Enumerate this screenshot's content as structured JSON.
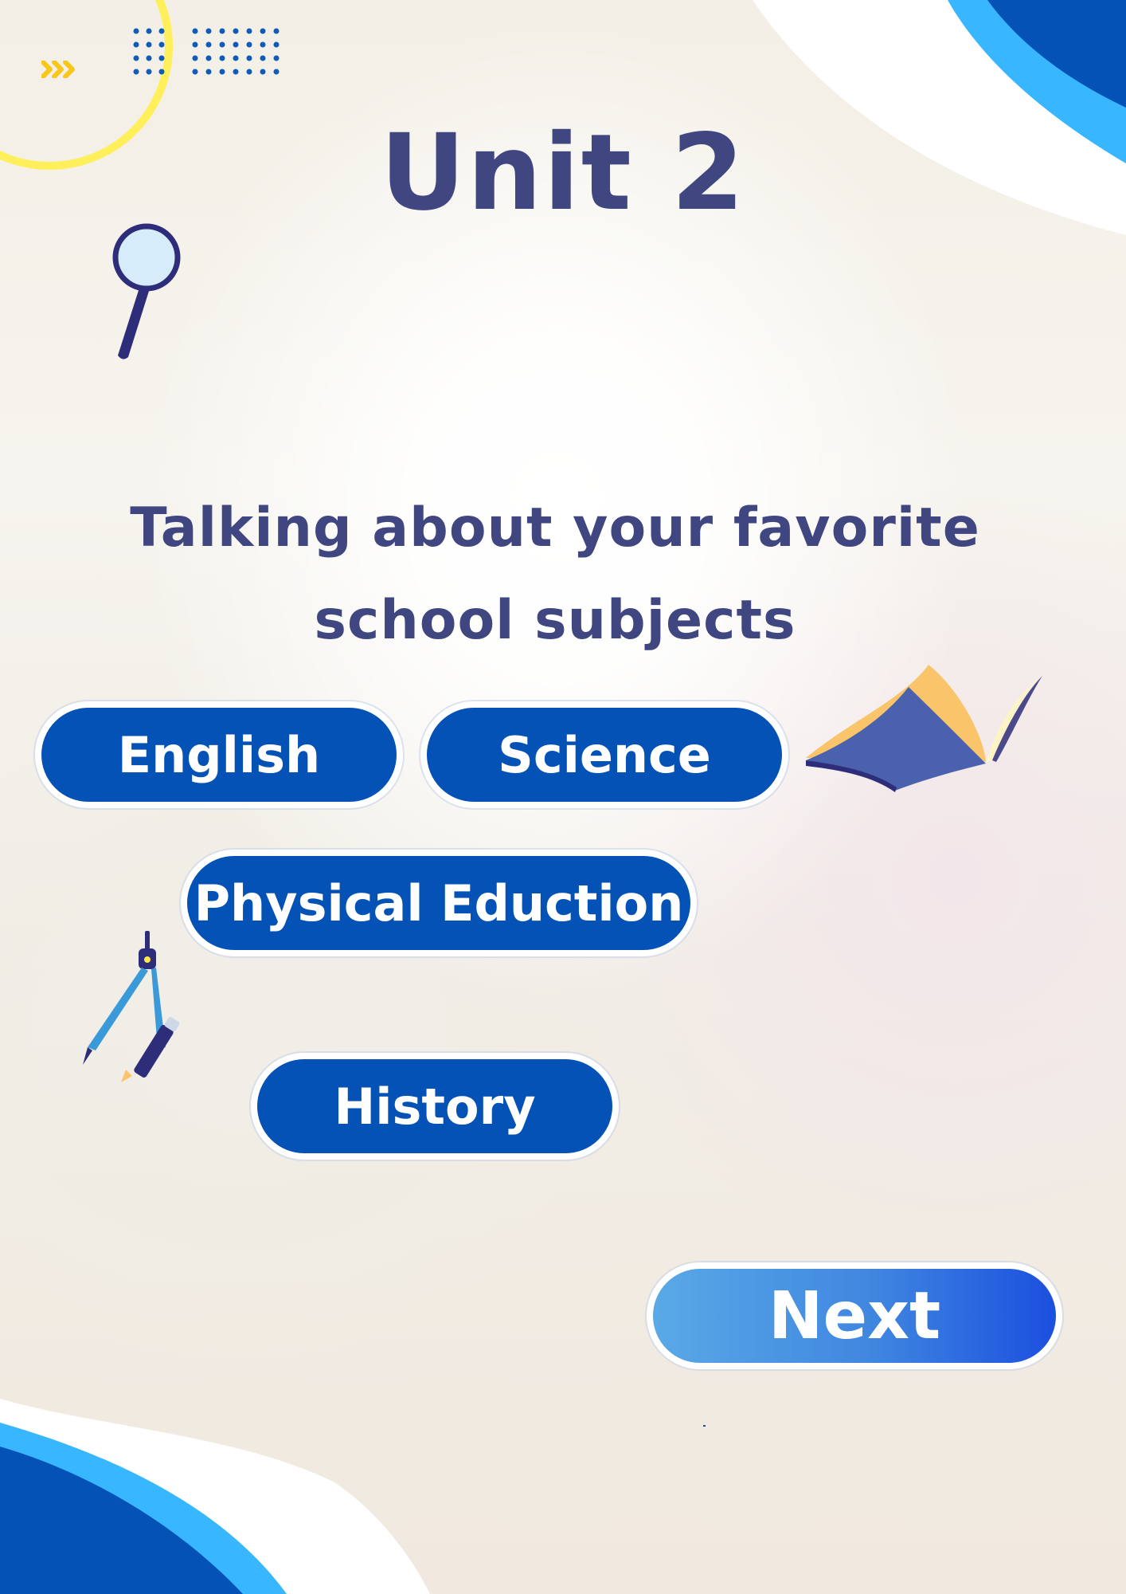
{
  "title": "Unit 2",
  "subtitle": {
    "line1": "Talking about your favorite",
    "line2": "school subjects"
  },
  "subjects": {
    "english": "English",
    "science": "Science",
    "physical_education": "Physical Eduction",
    "history": "History"
  },
  "next_label": "Next",
  "colors": {
    "title_text": "#3f4680",
    "pill_bg": "#0452b6",
    "accent_light_blue": "#38b6ff",
    "accent_dark_blue": "#0452b6",
    "accent_yellow": "#ffe94a"
  },
  "icons": [
    "chevrons-right-icon",
    "dot-grid-icon",
    "magnifying-glass-icon",
    "open-book-icon",
    "compass-tool-icon"
  ]
}
